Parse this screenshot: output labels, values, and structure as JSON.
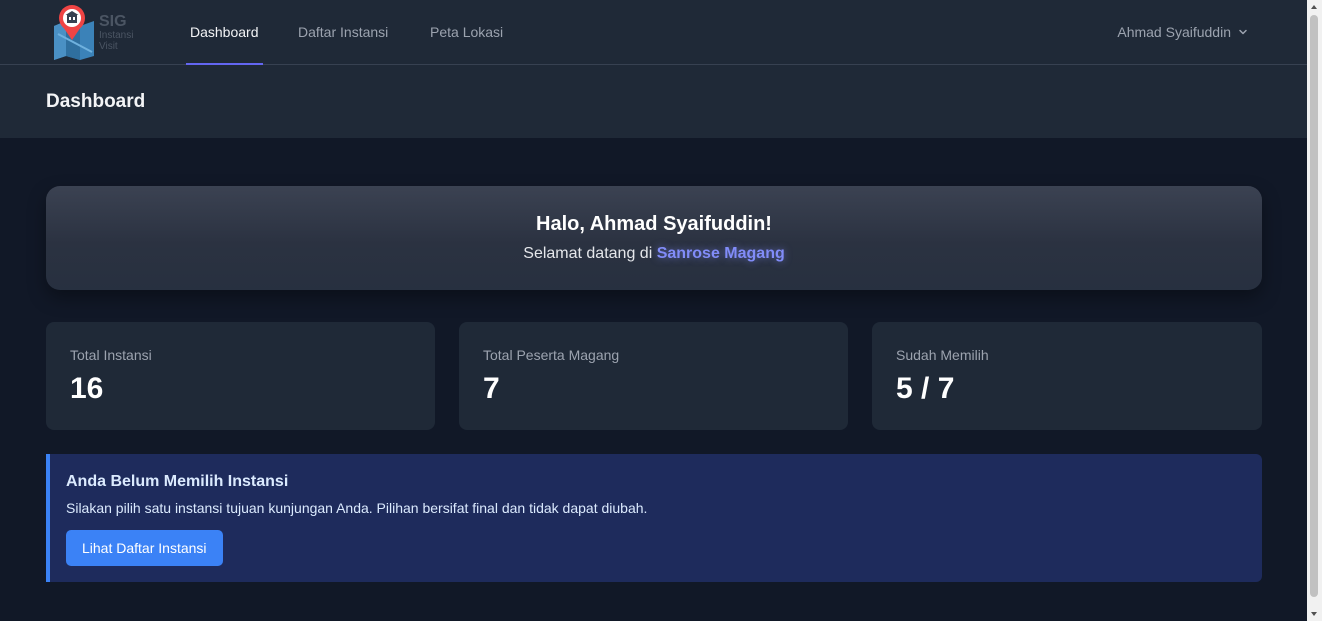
{
  "app": {
    "logo": {
      "line1": "SIG",
      "line2": "Instansi",
      "line3": "Visit"
    }
  },
  "nav": {
    "links": [
      {
        "label": "Dashboard",
        "active": true
      },
      {
        "label": "Daftar Instansi",
        "active": false
      },
      {
        "label": "Peta Lokasi",
        "active": false
      }
    ],
    "user": "Ahmad Syaifuddin"
  },
  "header": {
    "title": "Dashboard"
  },
  "welcome": {
    "greeting": "Halo, Ahmad Syaifuddin!",
    "subtitle_prefix": "Selamat datang di",
    "brand": "Sanrose Magang"
  },
  "stats": [
    {
      "label": "Total Instansi",
      "value": "16"
    },
    {
      "label": "Total Peserta Magang",
      "value": "7"
    },
    {
      "label": "Sudah Memilih",
      "value": "5 / 7"
    }
  ],
  "alert": {
    "title": "Anda Belum Memilih Instansi",
    "description": "Silakan pilih satu instansi tujuan kunjungan Anda. Pilihan bersifat final dan tidak dapat diubah.",
    "button": "Lihat Daftar Instansi"
  },
  "colors": {
    "background": "#111827",
    "card": "#1f2937",
    "accent": "#6366f1",
    "brand_text": "#818cf8",
    "alert_bg": "#1e2b5c",
    "alert_border": "#3b82f6",
    "button": "#3b82f6"
  },
  "icons": {
    "logo": "map-pin-building-icon",
    "user_menu": "chevron-down-icon"
  }
}
